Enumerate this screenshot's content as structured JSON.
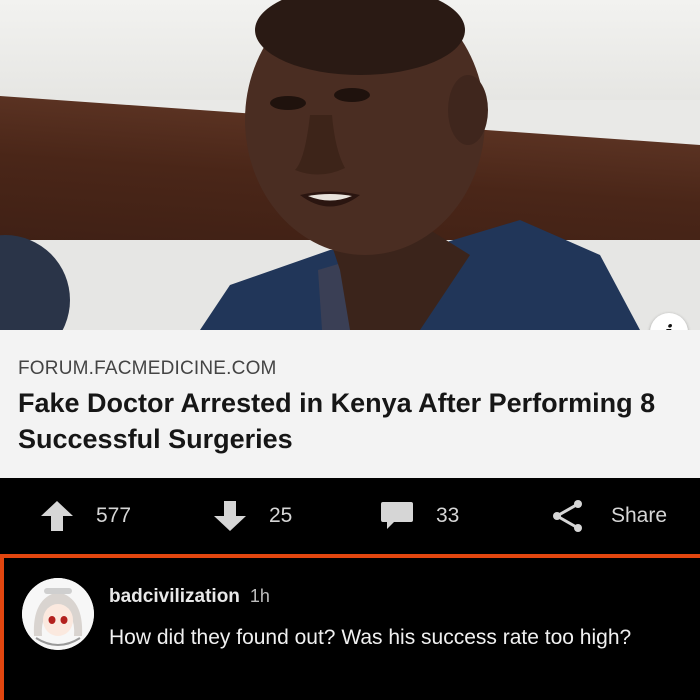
{
  "link_card": {
    "domain": "FORUM.FACMEDICINE.COM",
    "title": "Fake Doctor Arrested in Kenya After Performing 8 Successful Surgeries"
  },
  "info_icon": "i",
  "actions": {
    "upvotes": "577",
    "downvotes": "25",
    "comments": "33",
    "share_label": "Share"
  },
  "comment": {
    "username": "badcivilization",
    "time": "1h",
    "text": "How did they found out? Was his success rate too high?"
  },
  "colors": {
    "accent": "#e2460f",
    "card_bg": "#f3f3f3",
    "bar_bg": "#000000"
  },
  "icons": [
    "info-icon",
    "upvote-arrow-icon",
    "downvote-arrow-icon",
    "comment-bubble-icon",
    "share-icon"
  ]
}
